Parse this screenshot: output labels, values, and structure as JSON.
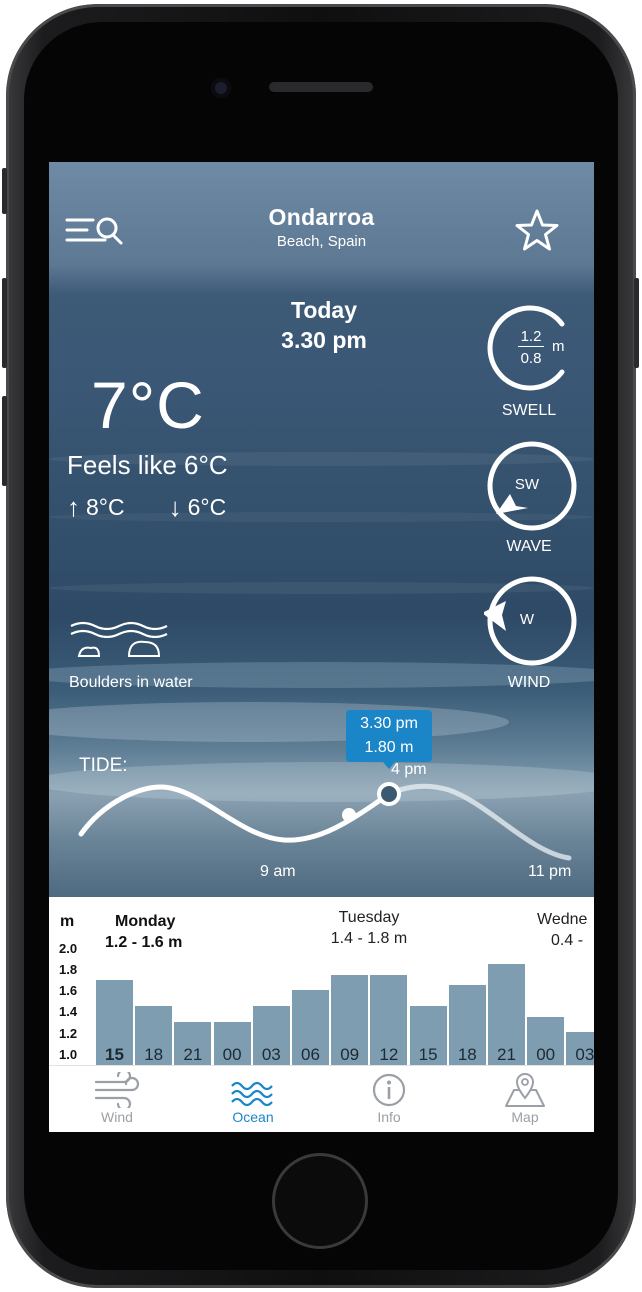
{
  "header": {
    "location": "Ondarroa",
    "subtitle": "Beach, Spain"
  },
  "datetime": {
    "day": "Today",
    "time": "3.30 pm"
  },
  "weather": {
    "temperature": "7°C",
    "feels_like": "Feels like 6°C",
    "max": "8°C",
    "min": "6°C"
  },
  "conditions": {
    "boulders_label": "Boulders in water"
  },
  "gauges": {
    "swell": {
      "top": "1.2",
      "bottom": "0.8",
      "unit": "m",
      "label": "SWELL"
    },
    "wave": {
      "direction": "SW",
      "label": "WAVE"
    },
    "wind": {
      "direction": "W",
      "label": "WIND"
    }
  },
  "tide": {
    "label": "TIDE:",
    "tooltip_time": "3.30 pm",
    "tooltip_height": "1.80 m",
    "times": [
      "9 am",
      "4 pm",
      "11 pm"
    ]
  },
  "chart": {
    "unit": "m",
    "y_ticks": [
      "2.0",
      "1.8",
      "1.6",
      "1.4",
      "1.2",
      "1.0"
    ],
    "days": [
      {
        "name": "Monday",
        "range": "1.2 - 1.6 m"
      },
      {
        "name": "Tuesday",
        "range": "1.4 - 1.8 m"
      },
      {
        "name": "Wedne",
        "range": "0.4 -"
      }
    ],
    "bars": [
      {
        "label": "15",
        "value": 1.8
      },
      {
        "label": "18",
        "value": 1.55
      },
      {
        "label": "21",
        "value": 1.4
      },
      {
        "label": "00",
        "value": 1.4
      },
      {
        "label": "03",
        "value": 1.55
      },
      {
        "label": "06",
        "value": 1.7
      },
      {
        "label": "09",
        "value": 1.85
      },
      {
        "label": "12",
        "value": 1.85
      },
      {
        "label": "15",
        "value": 1.55
      },
      {
        "label": "18",
        "value": 1.75
      },
      {
        "label": "21",
        "value": 1.95
      },
      {
        "label": "00",
        "value": 1.45
      },
      {
        "label": "03",
        "value": 1.3
      }
    ]
  },
  "tabs": [
    {
      "label": "Wind",
      "icon": "wind-icon"
    },
    {
      "label": "Ocean",
      "icon": "waves-icon"
    },
    {
      "label": "Info",
      "icon": "info-icon"
    },
    {
      "label": "Map",
      "icon": "map-icon"
    }
  ],
  "colors": {
    "accent": "#1a86c8",
    "bar": "#7f9db0"
  }
}
